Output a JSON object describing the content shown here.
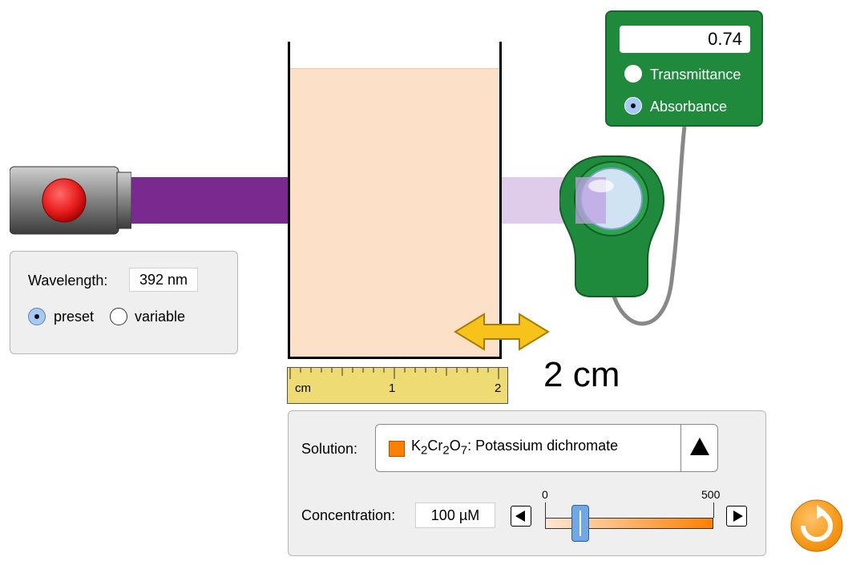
{
  "light": {
    "button_color": "#e81e1e",
    "beam_color": "#7a2a8e"
  },
  "wavelength": {
    "label": "Wavelength:",
    "value": "392 nm",
    "preset_label": "preset",
    "variable_label": "variable",
    "selected": "preset"
  },
  "ruler": {
    "unit": "cm",
    "mark_1": "1",
    "mark_2": "2"
  },
  "distance": {
    "label": "2 cm"
  },
  "meter": {
    "value": "0.74",
    "transmittance_label": "Transmittance",
    "absorbance_label": "Absorbance",
    "selected": "absorbance",
    "color": "#1f8a3c"
  },
  "solution": {
    "label": "Solution:",
    "name": "Potassium dichromate",
    "formula_parts": [
      "K",
      "2",
      "Cr",
      "2",
      "O",
      "7"
    ],
    "swatch_color": "#ff7f00"
  },
  "concentration": {
    "label": "Concentration:",
    "value": "100 µM",
    "slider_min": "0",
    "slider_max": "500",
    "slider_fraction": 0.2
  },
  "icons": {
    "reset": "reset-icon",
    "arrow": "double-arrow-icon",
    "dropdown": "triangle-up-icon"
  }
}
